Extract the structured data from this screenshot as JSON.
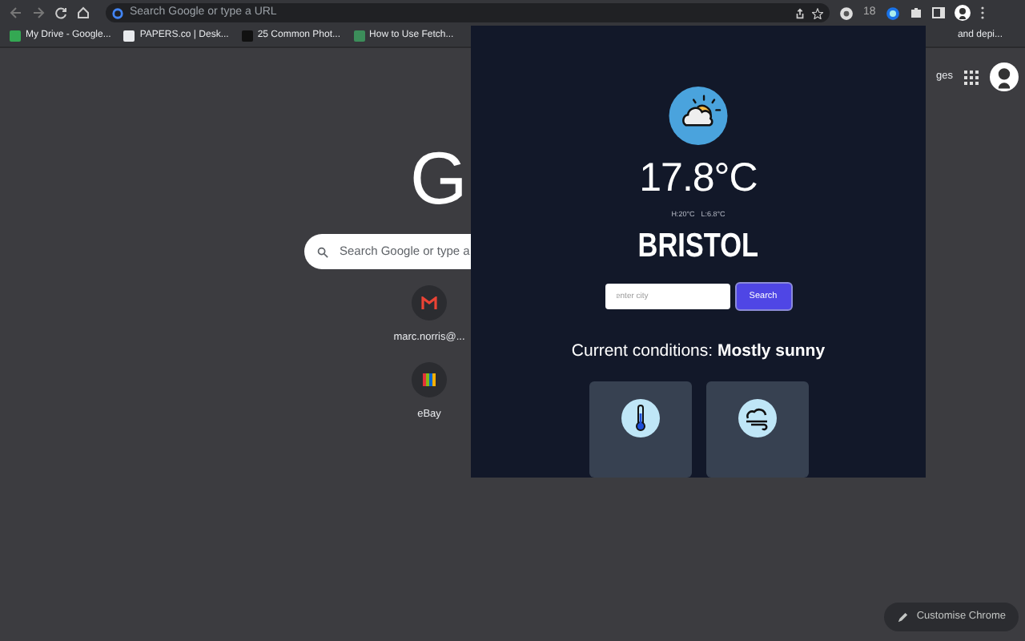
{
  "toolbar": {
    "omnibox_placeholder": "Search Google or type a URL",
    "extension_badge": "18"
  },
  "bookmarks": [
    {
      "label": "My Drive - Google..."
    },
    {
      "label": "PAPERS.co | Desk..."
    },
    {
      "label": "25 Common Phot..."
    },
    {
      "label": "How to Use Fetch..."
    },
    {
      "label": "and depi..."
    }
  ],
  "new_tab": {
    "header_link": "ges",
    "logo": "G",
    "search_placeholder": "Search Google or type a",
    "shortcuts": [
      {
        "label": "marc.norris@..."
      },
      {
        "label": "eBay"
      }
    ],
    "customise_button": "Customise Chrome"
  },
  "weather_popup": {
    "temperature": "17.8°C",
    "high": "H:20°C",
    "low": "L:6.8°C",
    "city": "BRISTOL",
    "city_placeholder": "enter city",
    "search_button": "Search",
    "conditions": "Current conditions: **Mostly sunny**",
    "cards": [
      {
        "kind": "temperature"
      },
      {
        "kind": "wind"
      }
    ]
  }
}
